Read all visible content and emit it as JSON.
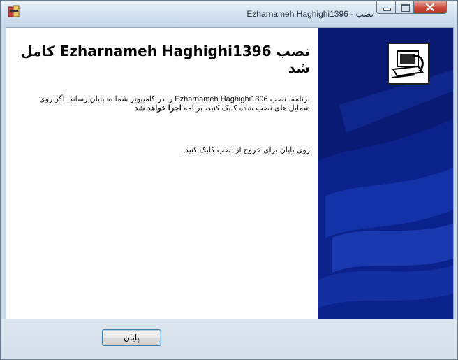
{
  "window": {
    "title": "Ezharnameh Haghighi1396 - نصب"
  },
  "main": {
    "heading": "نصب Ezharnameh Haghighi1396 کامل شد",
    "paragraph_part1": "برنامه، نصب Ezharnameh Haghighi1396 را در کامپیوتر شما به پایان رساند. اگر روی شمایل های نصب شده کلیک کنید، برنامه ",
    "paragraph_bold": "اجرا خواهد شد",
    "instruction": "روی پایان برای خروج از نصب کلیک کنید."
  },
  "footer": {
    "finish_label": "پایان"
  },
  "colors": {
    "side_panel": "#081a73",
    "close_button": "#c9483a",
    "accent": "#3c7fb1"
  },
  "icons": [
    "installer-app-icon",
    "minimize-icon",
    "maximize-icon",
    "close-icon",
    "setup-computer-icon"
  ]
}
